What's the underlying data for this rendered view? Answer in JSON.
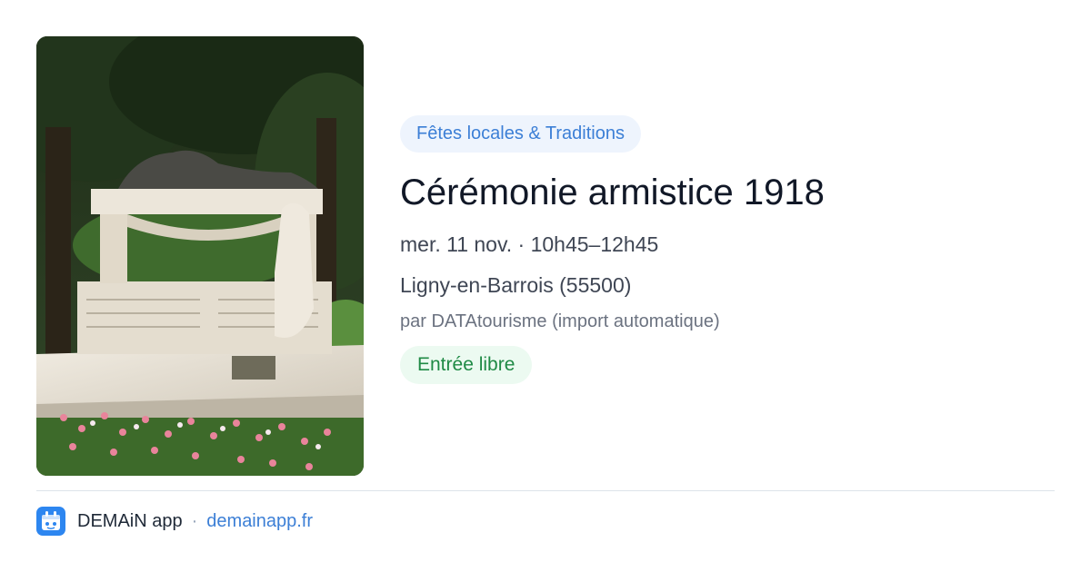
{
  "event": {
    "image": {
      "subject": "war-memorial-photo"
    },
    "category": "Fêtes locales & Traditions",
    "title": "Cérémonie armistice 1918",
    "when": "mer. 11 nov. · 10h45–12h45",
    "where": "Ligny-en-Barrois (55500)",
    "source": "par DATAtourisme (import automatique)",
    "price": "Entrée libre"
  },
  "footer": {
    "app_icon": "demain-app-icon",
    "app_name": "DEMAiN app",
    "separator": "·",
    "link": "demainapp.fr"
  },
  "colors": {
    "category_bg": "#eef4fd",
    "category_text": "#3c7fd6",
    "price_bg": "#ecfaf1",
    "price_text": "#1f8a45",
    "brand": "#2d86f0"
  }
}
